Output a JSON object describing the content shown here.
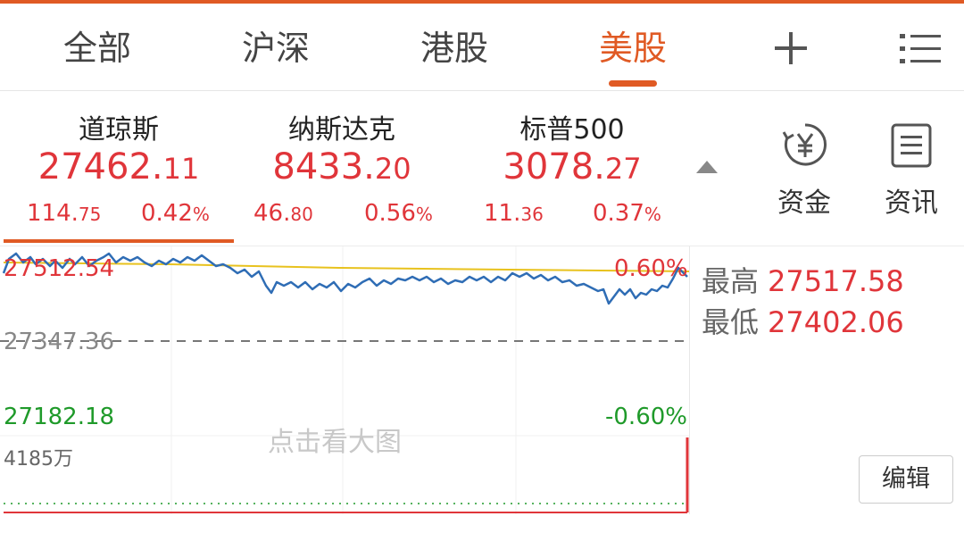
{
  "tabs": [
    {
      "label": "全部"
    },
    {
      "label": "沪深"
    },
    {
      "label": "港股"
    },
    {
      "label": "美股"
    }
  ],
  "active_tab": "美股",
  "indices": [
    {
      "name": "道琼斯",
      "value_int": "27462.",
      "value_dec": "11",
      "change_int": "114.",
      "change_dec": "75",
      "pct": "0.42",
      "pct_unit": "%"
    },
    {
      "name": "纳斯达克",
      "value_int": "8433.",
      "value_dec": "20",
      "change_int": "46.",
      "change_dec": "80",
      "pct": "0.56",
      "pct_unit": "%"
    },
    {
      "name": "标普500",
      "value_int": "3078.",
      "value_dec": "27",
      "change_int": "11.",
      "change_dec": "36",
      "pct": "0.37",
      "pct_unit": "%"
    }
  ],
  "side_buttons": {
    "funds": "资金",
    "news": "资讯"
  },
  "chart": {
    "top_price": "27512.54",
    "mid_price": "27347.36",
    "bottom_price": "27182.18",
    "top_pct": "0.60%",
    "bottom_pct": "-0.60%",
    "volume": "4185万",
    "hint": "点击看大图"
  },
  "stats": {
    "high_label": "最高",
    "high_value": "27517.58",
    "low_label": "最低",
    "low_value": "27402.06"
  },
  "edit_label": "编辑",
  "colors": {
    "accent": "#e05a24",
    "up": "#e0353a",
    "down": "#1f9a2a",
    "price_line": "#2f6db5",
    "avg_line": "#e8c21e"
  }
}
